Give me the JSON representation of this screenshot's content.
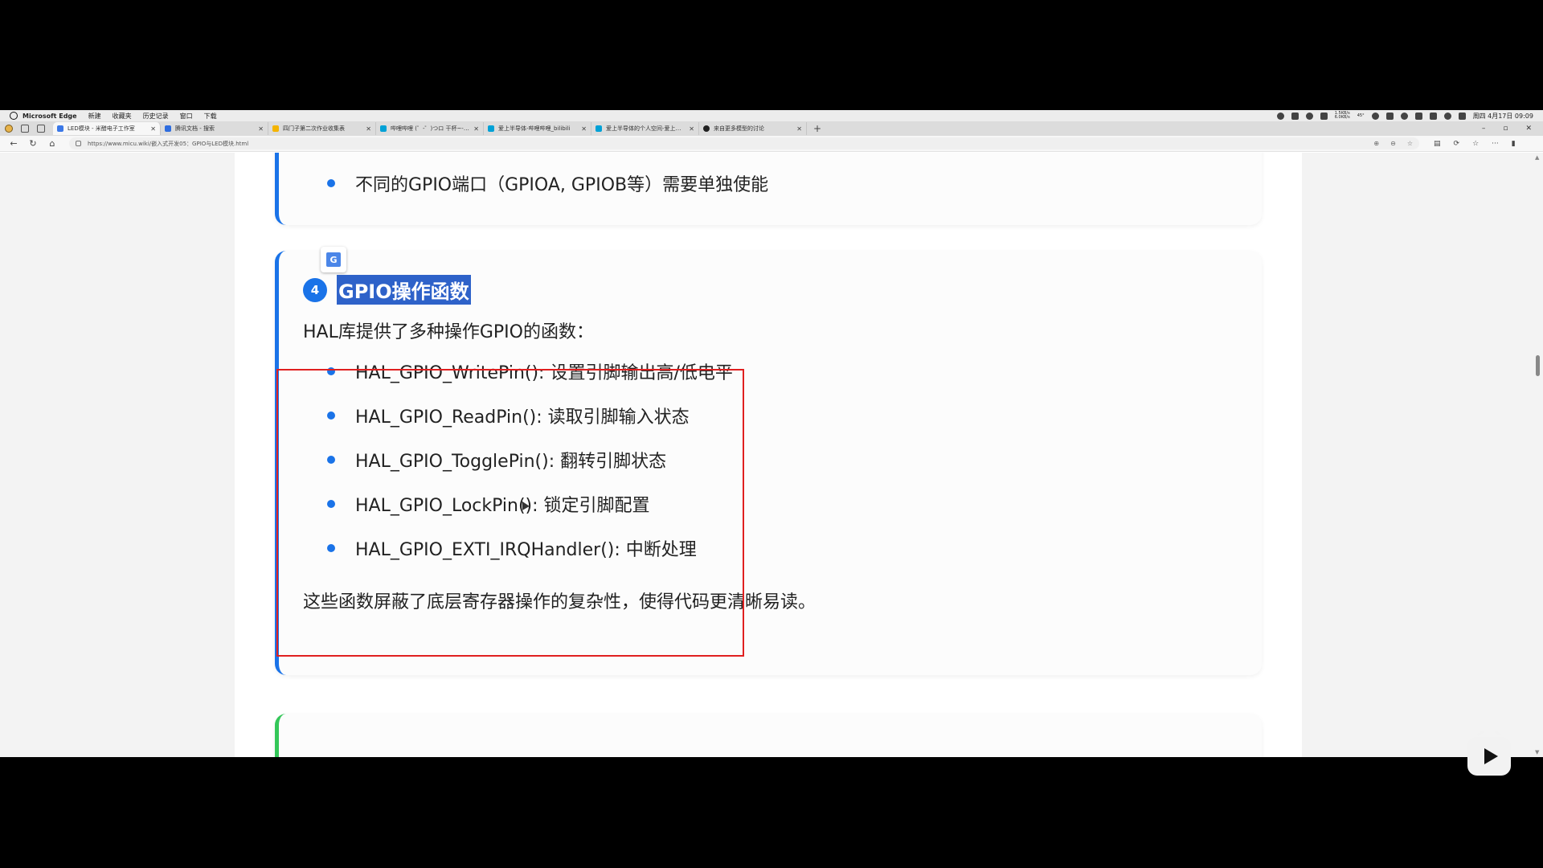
{
  "menubar": {
    "app": "Microsoft Edge",
    "items": [
      "新建",
      "收藏夹",
      "历史记录",
      "窗口",
      "下载"
    ],
    "net_up": "1.5KB/s",
    "net_down": "6.0KB/s",
    "temp": "45°",
    "clock": "周四 4月17日 09:09"
  },
  "tabs": [
    {
      "title": "LED模块 - 米醋电子工作室",
      "color": "#3b78e7",
      "active": true
    },
    {
      "title": "腾讯文档 - 搜索",
      "color": "#2d6cdf",
      "active": false
    },
    {
      "title": "四门子第二次作业收集表",
      "color": "#f4b400",
      "active": false
    },
    {
      "title": "哔哩哔哩 (゜-゜)つロ 干杯~-bilibili",
      "color": "#00a1d6",
      "active": false
    },
    {
      "title": "爱上半导体-哔哩哔哩_bilibili",
      "color": "#00a1d6",
      "active": false
    },
    {
      "title": "爱上半导体的个人空间-爱上半导体",
      "color": "#00a1d6",
      "active": false
    },
    {
      "title": "来自更多模型的讨论",
      "color": "#222222",
      "active": false
    }
  ],
  "address": {
    "url": "https://www.micu.wiki/嵌入式开发05：GPIO与LED模块.html"
  },
  "page": {
    "prev_card_bullet": "不同的GPIO端口（GPIOA, GPIOB等）需要单独使能",
    "section": {
      "number": "4",
      "title": "GPIO操作函数",
      "intro": "HAL库提供了多种操作GPIO的函数：",
      "bullets": [
        "HAL_GPIO_WritePin(): 设置引脚输出高/低电平",
        "HAL_GPIO_ReadPin(): 读取引脚输入状态",
        "HAL_GPIO_TogglePin(): 翻转引脚状态",
        "HAL_GPIO_LockPin(): 锁定引脚配置",
        "HAL_GPIO_EXTI_IRQHandler(): 中断处理"
      ],
      "summary": "这些函数屏蔽了底层寄存器操作的复杂性，使得代码更清晰易读。"
    }
  },
  "translate_icon_letter": "G",
  "colors": {
    "accent": "#1a73e8",
    "highlight": "#2e62c9",
    "annotation": "#e02020",
    "next_card": "#34c759"
  }
}
